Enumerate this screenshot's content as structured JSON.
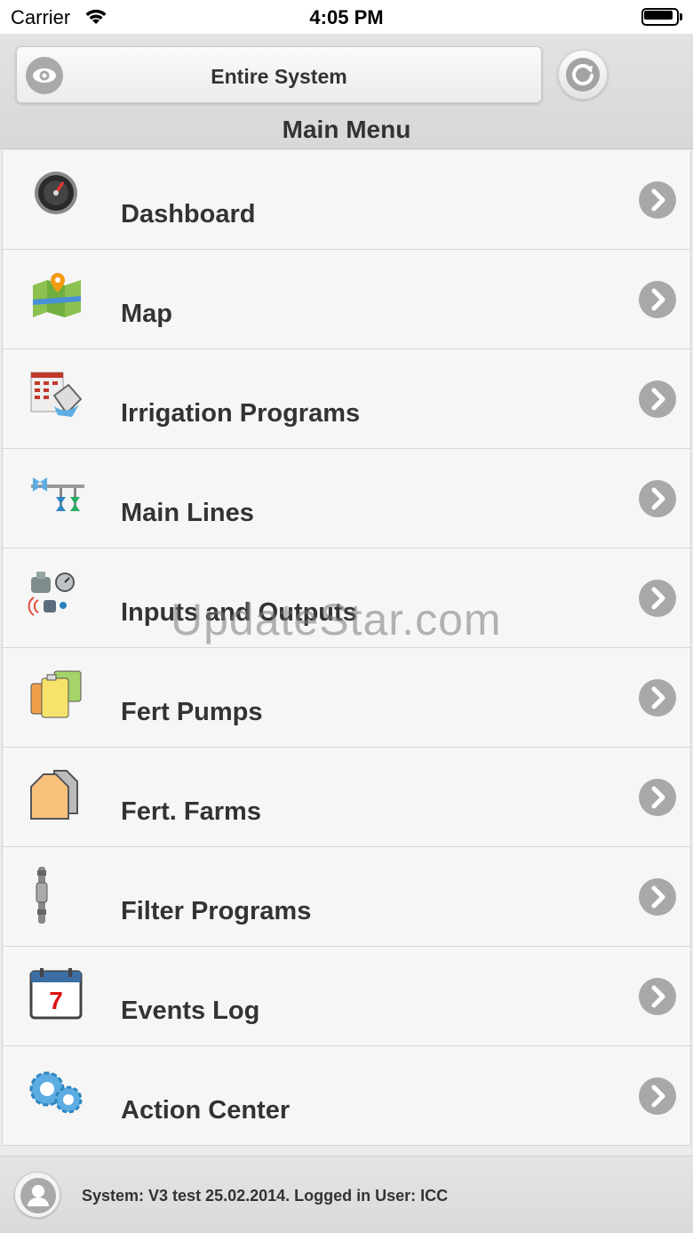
{
  "status": {
    "carrier": "Carrier",
    "time": "4:05 PM"
  },
  "header": {
    "system_label": "Entire System",
    "title": "Main Menu"
  },
  "menu": {
    "items": [
      {
        "label": "Dashboard",
        "icon": "dashboard-gauge-icon"
      },
      {
        "label": "Map",
        "icon": "map-icon"
      },
      {
        "label": "Irrigation Programs",
        "icon": "irrigation-programs-icon"
      },
      {
        "label": "Main Lines",
        "icon": "main-lines-icon"
      },
      {
        "label": "Inputs and Outputs",
        "icon": "inputs-outputs-icon"
      },
      {
        "label": "Fert Pumps",
        "icon": "fert-pumps-icon"
      },
      {
        "label": "Fert. Farms",
        "icon": "fert-farms-icon"
      },
      {
        "label": "Filter Programs",
        "icon": "filter-programs-icon"
      },
      {
        "label": "Events Log",
        "icon": "calendar-icon"
      },
      {
        "label": "Action Center",
        "icon": "gears-icon"
      }
    ]
  },
  "calendar_day": "7",
  "watermark": "UpdateStar.com",
  "footer": {
    "text": "System: V3 test 25.02.2014. Logged in User: ICC"
  }
}
